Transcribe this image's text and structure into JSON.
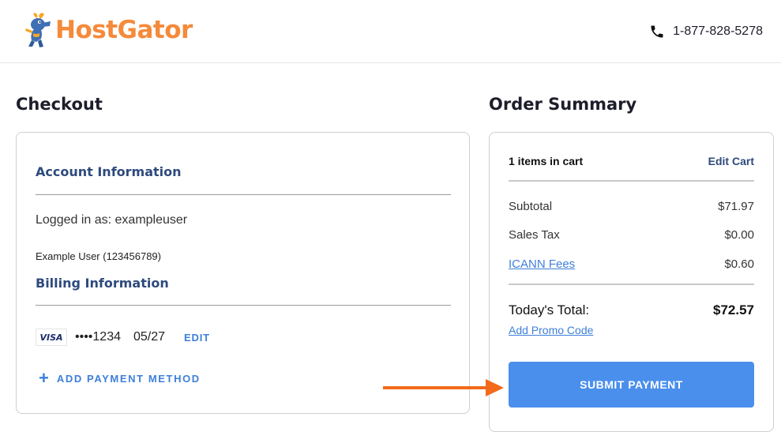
{
  "header": {
    "logo_text": "HostGator",
    "phone": "1-877-828-5278"
  },
  "checkout": {
    "title": "Checkout",
    "account": {
      "heading": "Account Information",
      "logged_in_text": "Logged in as: exampleuser",
      "user_line": "Example User (123456789)"
    },
    "billing": {
      "heading": "Billing Information",
      "card_brand": "VISA",
      "card_number": "••••1234",
      "card_expiry": "05/27",
      "edit_label": "EDIT",
      "add_payment_label": "ADD PAYMENT METHOD"
    }
  },
  "summary": {
    "title": "Order Summary",
    "items_count": "1 items in cart",
    "edit_cart_label": "Edit Cart",
    "rows": [
      {
        "label": "Subtotal",
        "value": "$71.97"
      },
      {
        "label": "Sales Tax",
        "value": "$0.00"
      },
      {
        "label": "ICANN Fees",
        "value": "$0.60"
      }
    ],
    "total_label": "Today's Total:",
    "total_value": "$72.57",
    "promo_label": "Add Promo Code",
    "submit_label": "SUBMIT PAYMENT"
  },
  "colors": {
    "brand_orange": "#f58a3a",
    "accent_blue": "#4a8fec",
    "heading_navy": "#2e4a7d",
    "arrow_orange": "#f26a1b"
  },
  "icons": {
    "phone": "phone-icon",
    "plus": "plus-icon",
    "mascot": "gator-mascot-icon",
    "arrow": "arrow-right-icon"
  }
}
